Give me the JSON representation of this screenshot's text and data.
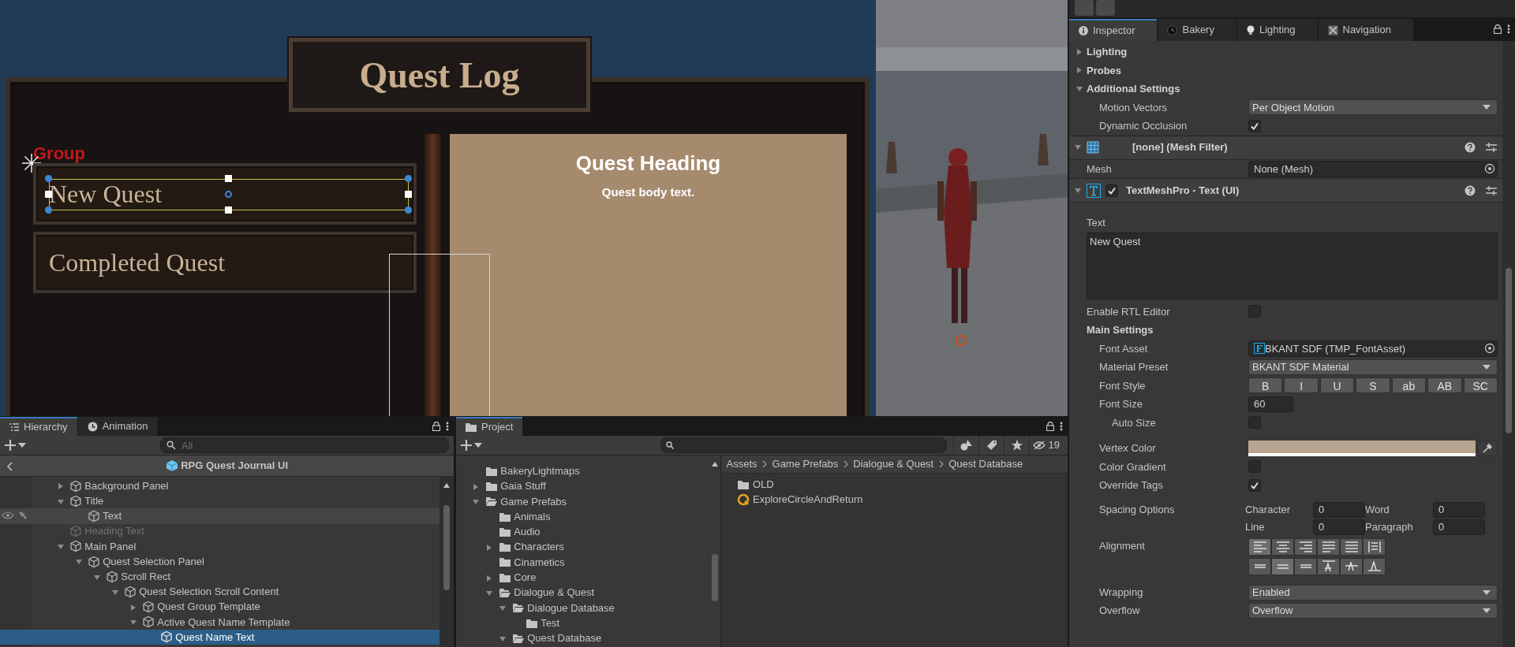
{
  "scene": {
    "title": "Quest Log",
    "group_label": "Group",
    "quest_buttons": [
      {
        "label": "New Quest",
        "selected": true
      },
      {
        "label": "Completed Quest",
        "selected": false
      }
    ],
    "heading": "Quest Heading",
    "body": "Quest body text."
  },
  "inspector": {
    "tabs": [
      {
        "label": "Inspector",
        "selected": true
      },
      {
        "label": "Bakery",
        "selected": false
      },
      {
        "label": "Lighting",
        "selected": false
      },
      {
        "label": "Navigation",
        "selected": false
      }
    ],
    "rows": [
      {
        "kind": "foldout",
        "label": "Lighting",
        "expanded": false
      },
      {
        "kind": "foldout",
        "label": "Probes",
        "expanded": false
      },
      {
        "kind": "foldout",
        "label": "Additional Settings",
        "expanded": true,
        "children": [
          {
            "kind": "dropdown",
            "label": "Motion Vectors",
            "value": "Per Object Motion"
          },
          {
            "kind": "checkbox",
            "label": "Dynamic Occlusion",
            "checked": true
          }
        ]
      },
      {
        "kind": "mesh_component",
        "title": "[none] (Mesh Filter)",
        "expanded": true
      },
      {
        "kind": "object",
        "label": "Mesh",
        "value": "None (Mesh)"
      },
      {
        "kind": "text_component",
        "title": "TextMeshPro - Text (UI)",
        "expanded": true,
        "enabled": true
      },
      {
        "kind": "textarea",
        "label": "Text",
        "value": "New Quest"
      },
      {
        "kind": "checkbox",
        "label": "Enable RTL Editor",
        "checked": false
      },
      {
        "kind": "heading",
        "label": "Main Settings",
        "children": [
          {
            "kind": "object",
            "label": "Font Asset",
            "value": "BKANT SDF (TMP_FontAsset)",
            "asset": true
          },
          {
            "kind": "dropdown",
            "label": "Material Preset",
            "value": "BKANT SDF Material"
          },
          {
            "kind": "styles",
            "label": "Font Style",
            "buttons": [
              {
                "label": "B",
                "selected": false
              },
              {
                "label": "I",
                "selected": false
              },
              {
                "label": "U",
                "selected": false
              },
              {
                "label": "S",
                "selected": false
              },
              {
                "label": "ab",
                "selected": false
              },
              {
                "label": "AB",
                "selected": false
              },
              {
                "label": "SC",
                "selected": false
              }
            ]
          },
          {
            "kind": "number",
            "label": "Font Size",
            "value": "60",
            "children": [
              {
                "kind": "checkbox",
                "label": "Auto Size",
                "checked": false
              }
            ]
          },
          {
            "kind": "color",
            "label": "Vertex Color",
            "color": "#b8a590"
          },
          {
            "kind": "checkbox",
            "label": "Color Gradient",
            "checked": false
          },
          {
            "kind": "checkbox",
            "label": "Override Tags",
            "checked": true
          },
          {
            "kind": "spacing",
            "label": "Spacing Options",
            "fields": [
              {
                "label": "Character",
                "value": "0"
              },
              {
                "label": "Word",
                "value": "0"
              },
              {
                "label": "Line",
                "value": "0"
              },
              {
                "label": "Paragraph",
                "value": "0"
              }
            ]
          },
          {
            "kind": "alignment",
            "label": "Alignment",
            "horizontal": [
              {
                "selected": true
              },
              {
                "selected": false
              },
              {
                "selected": false
              },
              {
                "selected": false
              },
              {
                "selected": false
              },
              {
                "selected": false
              }
            ],
            "vertical": [
              {
                "selected": false
              },
              {
                "selected": true
              },
              {
                "selected": false
              },
              {
                "selected": false
              },
              {
                "selected": false
              },
              {
                "selected": false
              }
            ]
          },
          {
            "kind": "dropdown",
            "label": "Wrapping",
            "value": "Enabled"
          },
          {
            "kind": "dropdown",
            "label": "Overflow",
            "value": "Overflow"
          }
        ]
      }
    ]
  },
  "hierarchy": {
    "tabs": [
      {
        "label": "Hierarchy",
        "selected": true
      },
      {
        "label": "Animation",
        "selected": false
      }
    ],
    "search": {
      "placeholder": "All"
    },
    "prefab": "RPG Quest Journal UI",
    "items": [
      {
        "name": "Background Panel",
        "expanded": false,
        "selected": false,
        "active": true
      },
      {
        "name": "Title",
        "expanded": true,
        "selected": false,
        "active": true,
        "children": [
          {
            "name": "Text",
            "selected": false,
            "active": true,
            "hovered": true
          }
        ]
      },
      {
        "name": "Heading Text",
        "selected": false,
        "active": false
      },
      {
        "name": "Main Panel",
        "expanded": true,
        "selected": false,
        "active": true,
        "children": [
          {
            "name": "Quest Selection Panel",
            "expanded": true,
            "selected": false,
            "active": true,
            "children": [
              {
                "name": "Scroll Rect",
                "expanded": true,
                "selected": false,
                "active": true,
                "children": [
                  {
                    "name": "Quest Selection Scroll Content",
                    "expanded": true,
                    "selected": false,
                    "active": true,
                    "children": [
                      {
                        "name": "Quest Group Template",
                        "expanded": false,
                        "selected": false,
                        "active": true
                      },
                      {
                        "name": "Active Quest Name Template",
                        "expanded": true,
                        "selected": false,
                        "active": true,
                        "children": [
                          {
                            "name": "Quest Name Text",
                            "selected": true,
                            "active": true
                          }
                        ]
                      }
                    ]
                  }
                ]
              }
            ]
          }
        ]
      }
    ]
  },
  "project": {
    "tab": "Project",
    "hidden_count": "19",
    "tree": [
      {
        "name": "BakeryLightmaps"
      },
      {
        "name": "Gaia Stuff",
        "expanded": false
      },
      {
        "name": "Game Prefabs",
        "expanded": true,
        "children": [
          {
            "name": "Animals"
          },
          {
            "name": "Audio"
          },
          {
            "name": "Characters",
            "expanded": false
          },
          {
            "name": "Cinametics"
          },
          {
            "name": "Core",
            "expanded": false
          },
          {
            "name": "Dialogue & Quest",
            "expanded": true,
            "children": [
              {
                "name": "Dialogue Database",
                "expanded": true,
                "children": [
                  {
                    "name": "Test"
                  }
                ]
              },
              {
                "name": "Quest Database",
                "expanded": true
              }
            ]
          }
        ]
      }
    ],
    "breadcrumb": [
      "Assets",
      "Game Prefabs",
      "Dialogue & Quest",
      "Quest Database"
    ],
    "assets": [
      {
        "name": "OLD",
        "kind": "folder"
      },
      {
        "name": "ExploreCircleAndReturn",
        "kind": "quest"
      }
    ]
  }
}
